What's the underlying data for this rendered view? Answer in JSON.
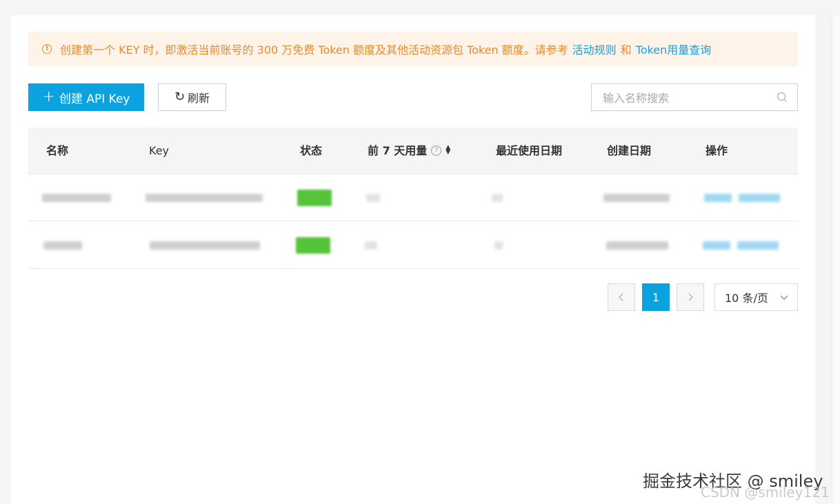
{
  "notice": {
    "text": "创建第一个 KEY 时，即激活当前账号的 300 万免费 Token 额度及其他活动资源包 Token 额度。请参考",
    "link_rules": "活动规则",
    "connector": "和",
    "link_usage": "Token用量查询",
    "icon": "warning-circle-icon"
  },
  "toolbar": {
    "create_label": "创建 API Key",
    "refresh_label": "刷新",
    "search_placeholder": "输入名称搜索"
  },
  "table": {
    "columns": {
      "name": "名称",
      "key": "Key",
      "status": "状态",
      "usage_7d": "前 7 天用量",
      "last_used": "最近使用日期",
      "created": "创建日期",
      "actions": "操作"
    },
    "rows_note": "row contents are blurred in the screenshot"
  },
  "pagination": {
    "prev_icon": "chevron-left-icon",
    "current_page": "1",
    "next_icon": "chevron-right-icon",
    "page_size": "10 条/页"
  },
  "watermark": {
    "primary": "掘金技术社区 @ smiley",
    "secondary": "CSDN @smiley121"
  },
  "colors": {
    "accent": "#0aa3e0",
    "notice_text": "#e88a2e",
    "notice_bg": "#fdf3e9",
    "link": "#1a9fdc",
    "status_green": "#55c43a"
  }
}
